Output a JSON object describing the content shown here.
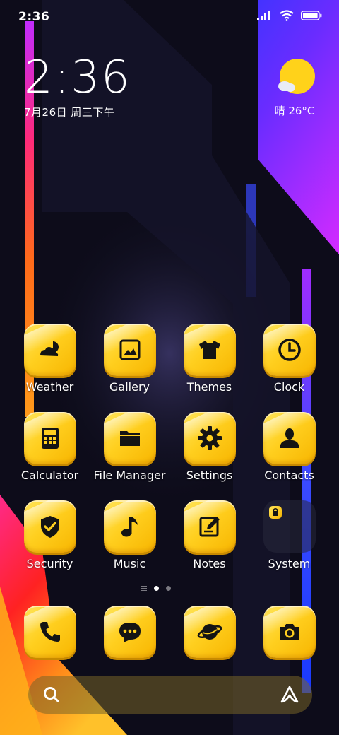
{
  "status_bar": {
    "time": "2:36",
    "signal_icon": "signal-icon",
    "wifi_icon": "wifi-icon",
    "battery_icon": "battery-icon"
  },
  "clock_widget": {
    "time": "2:36",
    "date": "7月26日 周三下午"
  },
  "weather_widget": {
    "icon": "partly-sunny-icon",
    "text": "晴 26°C"
  },
  "apps": [
    {
      "label": "Weather",
      "icon": "weather-icon"
    },
    {
      "label": "Gallery",
      "icon": "gallery-icon"
    },
    {
      "label": "Themes",
      "icon": "tshirt-icon"
    },
    {
      "label": "Clock",
      "icon": "clock-icon"
    },
    {
      "label": "Calculator",
      "icon": "calculator-icon"
    },
    {
      "label": "File Manager",
      "icon": "folder-icon"
    },
    {
      "label": "Settings",
      "icon": "gear-icon"
    },
    {
      "label": "Contacts",
      "icon": "person-icon"
    },
    {
      "label": "Security",
      "icon": "shield-check-icon"
    },
    {
      "label": "Music",
      "icon": "music-note-icon"
    },
    {
      "label": "Notes",
      "icon": "notes-edit-icon"
    },
    {
      "label": "System",
      "icon": "folder-icon"
    }
  ],
  "dock": [
    {
      "icon": "phone-icon"
    },
    {
      "icon": "message-icon"
    },
    {
      "icon": "planet-icon"
    },
    {
      "icon": "camera-icon"
    }
  ],
  "page_indicator": {
    "pages": 2,
    "current": 1
  },
  "search_bar": {
    "search_icon": "search-icon",
    "assistant_icon": "assistant-icon"
  },
  "colors": {
    "icon_yellow": "#ffcf1f",
    "icon_glyph": "#141414",
    "background": "#0d0c1a"
  }
}
